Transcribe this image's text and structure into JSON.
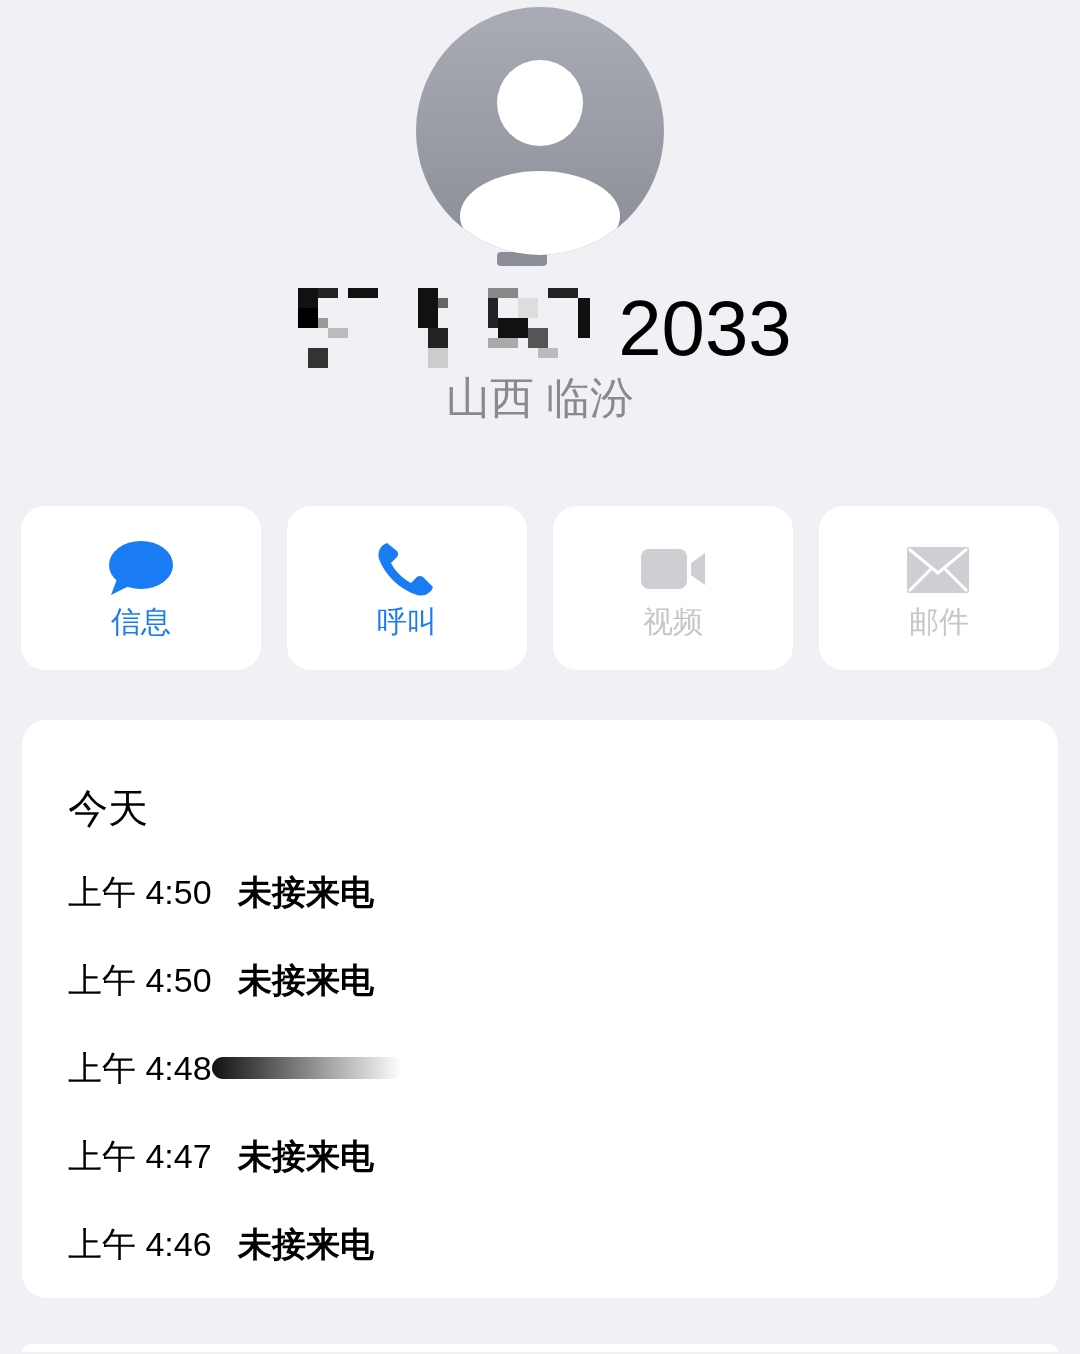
{
  "contact": {
    "number_visible": "2033",
    "number_redacted": true,
    "location": "山西 临汾"
  },
  "actions": [
    {
      "kind": "message",
      "label": "信息",
      "disabled": false
    },
    {
      "kind": "call",
      "label": "呼叫",
      "disabled": false
    },
    {
      "kind": "video",
      "label": "视频",
      "disabled": true
    },
    {
      "kind": "mail",
      "label": "邮件",
      "disabled": true
    }
  ],
  "history": {
    "heading": "今天",
    "entries": [
      {
        "time": "上午 4:50",
        "status": "未接来电",
        "redacted": false
      },
      {
        "time": "上午 4:50",
        "status": "未接来电",
        "redacted": false
      },
      {
        "time": "上午 4:48",
        "redacted": true
      },
      {
        "time": "上午 4:47",
        "status": "未接来电",
        "redacted": false
      },
      {
        "time": "上午 4:46",
        "status": "未接来电",
        "redacted": false
      }
    ]
  }
}
